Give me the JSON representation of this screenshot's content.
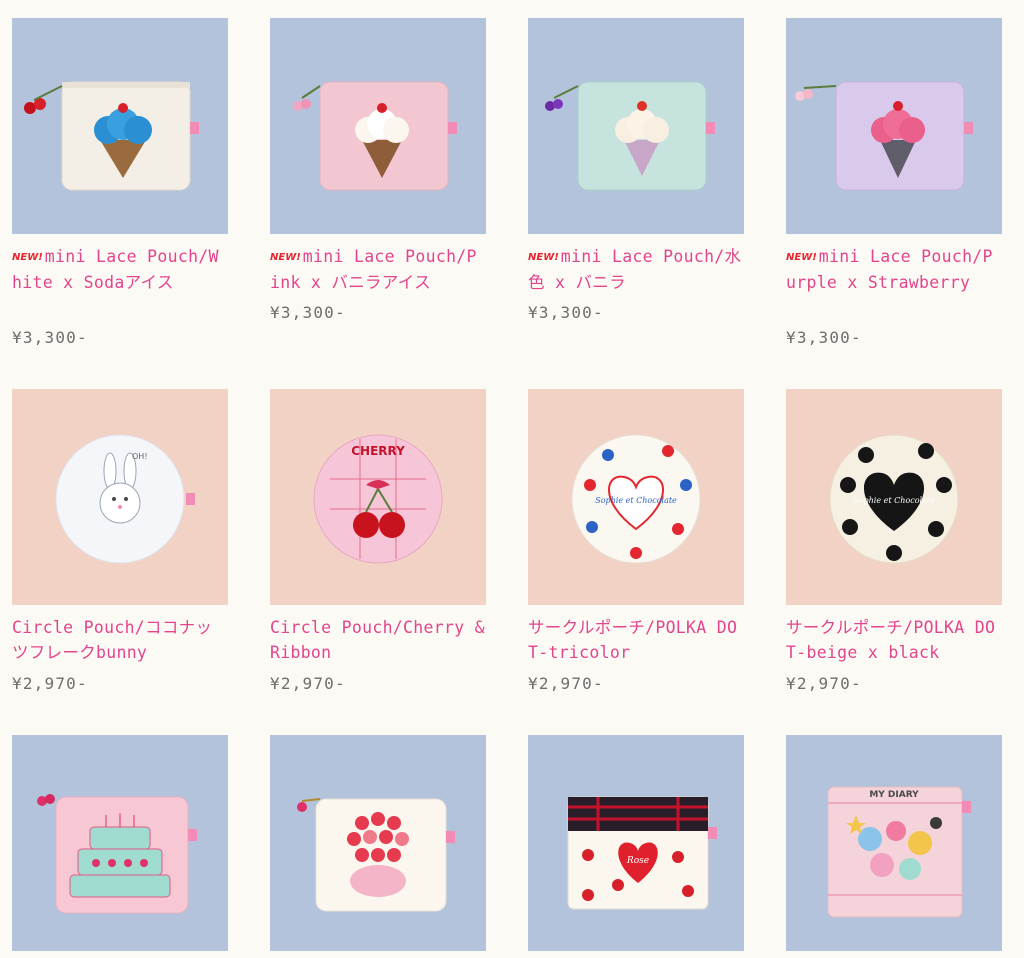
{
  "products": [
    {
      "badge": "NEW!",
      "title": "mini Lace Pouch/White x Sodaアイス",
      "price": "¥3,300-"
    },
    {
      "badge": "NEW!",
      "title": "mini Lace Pouch/Pink x バニラアイス",
      "price": "¥3,300-"
    },
    {
      "badge": "NEW!",
      "title": "mini Lace Pouch/水色 x バニラ",
      "price": "¥3,300-"
    },
    {
      "badge": "NEW!",
      "title": "mini Lace Pouch/Purple x Strawberry",
      "price": "¥3,300-"
    },
    {
      "badge": "",
      "title": "Circle Pouch/ココナッツフレークbunny",
      "price": "¥2,970-"
    },
    {
      "badge": "",
      "title": "Circle Pouch/Cherry & Ribbon",
      "price": "¥2,970-"
    },
    {
      "badge": "",
      "title": "サークルポーチ/POLKA DOT-tricolor",
      "price": "¥2,970-"
    },
    {
      "badge": "",
      "title": "サークルポーチ/POLKA DOT-beige x black",
      "price": "¥2,970-"
    },
    {
      "badge": "",
      "title": "",
      "price": ""
    },
    {
      "badge": "",
      "title": "",
      "price": ""
    },
    {
      "badge": "",
      "title": "",
      "price": ""
    },
    {
      "badge": "",
      "title": "",
      "price": ""
    }
  ],
  "photo_text": {
    "cherry_label": "CHERRY",
    "sophie_tricolor": "Sophie et Chocolate",
    "sophie_black": "Sophie et Chocolate",
    "bunny_speech": "OH!",
    "rose_label": "Rose",
    "diary_label": "MY DIARY"
  },
  "colors": {
    "accent_pink": "#e3458c",
    "new_badge_red": "#e8252f",
    "price_gray": "#6e6e6e",
    "page_bg": "#fcfaf5",
    "photo_bg_blue": "#b3c3db",
    "photo_bg_peach": "#f3d2c6"
  }
}
